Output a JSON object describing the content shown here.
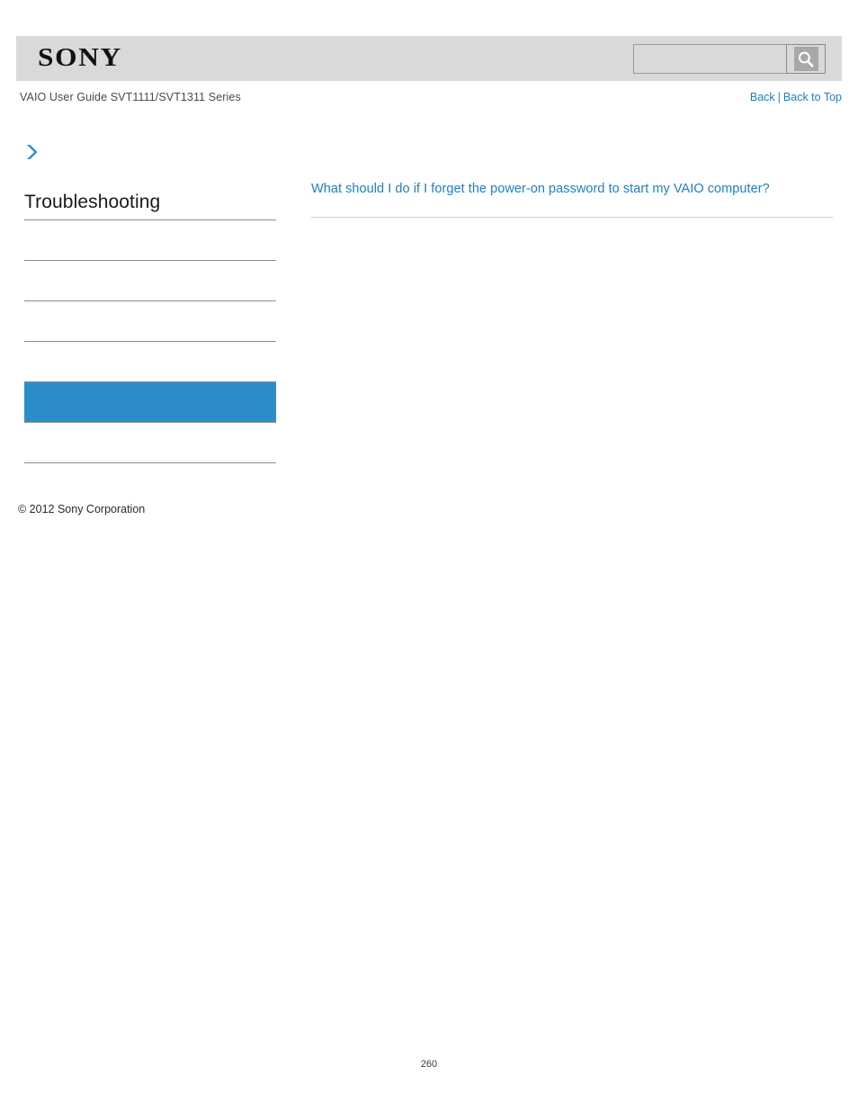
{
  "header": {
    "brand": "SONY",
    "search": {
      "value": "",
      "placeholder": "",
      "icon": "search-icon"
    }
  },
  "breadcrumb": {
    "guide_title": "VAIO User Guide SVT1111/SVT1311 Series",
    "back_label": "Back",
    "separator": "|",
    "back_to_top_label": "Back to Top"
  },
  "sidebar": {
    "marker_icon": "chevron-right-icon",
    "title": "Troubleshooting",
    "accent_color": "#2b8ecb",
    "items": [
      {
        "label": "",
        "selected": false
      },
      {
        "label": "",
        "selected": false
      },
      {
        "label": "",
        "selected": false
      },
      {
        "label": "",
        "selected": false
      },
      {
        "label": "",
        "selected": true
      },
      {
        "label": "",
        "selected": false
      }
    ]
  },
  "main": {
    "link_text": "What should I do if I forget the power-on password to start my VAIO computer?"
  },
  "footer": {
    "copyright": "© 2012 Sony Corporation",
    "page_number": "260"
  }
}
